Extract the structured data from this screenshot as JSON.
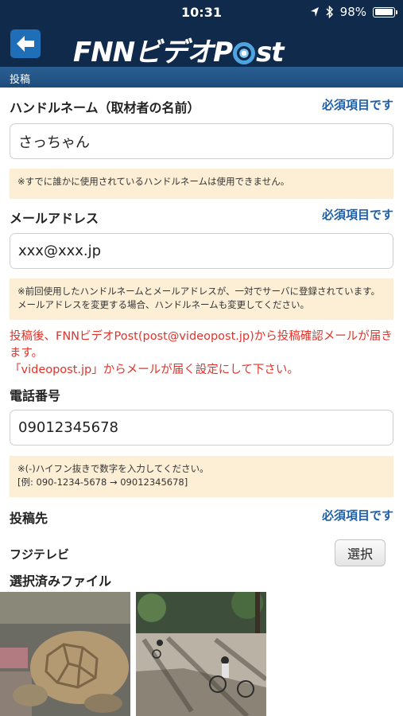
{
  "status_bar": {
    "time": "10:31",
    "battery": "98%",
    "battery_level": 0.98
  },
  "nav": {
    "logo_text_1": "FNN",
    "logo_text_2": "ビデオP",
    "logo_text_3": "st"
  },
  "section": {
    "title": "投稿"
  },
  "form": {
    "handle": {
      "label": "ハンドルネーム（取材者の名前）",
      "required": "必須項目です",
      "value": "さっちゃん",
      "note": "※すでに誰かに使用されているハンドルネームは使用できません。"
    },
    "email": {
      "label": "メールアドレス",
      "required": "必須項目です",
      "value": "xxx@xxx.jp",
      "note": "※前回使用したハンドルネームとメールアドレスが、一対でサーバに登録されています。メールアドレスを変更する場合、ハンドルネームも変更してください。"
    },
    "warning": {
      "line1": "投稿後、FNNビデオPost(post@videopost.jp)から投稿確認メールが届きます。",
      "line2": "「videopost.jp」からメールが届く設定にして下さい。"
    },
    "phone": {
      "label": "電話番号",
      "value": "09012345678",
      "note_line1": "※(-)ハイフン抜きで数字を入力してください。",
      "note_line2": "[例: 090-1234-5678 → 09012345678]"
    },
    "destination": {
      "label": "投稿先",
      "required": "必須項目です",
      "value": "フジテレビ",
      "select_label": "選択"
    },
    "files": {
      "label": "選択済みファイル"
    }
  },
  "colors": {
    "nav_bg": "#0f2a4a",
    "accent_blue": "#1e5fa8",
    "note_bg": "#fcefd6",
    "warning_red": "#e2332b"
  }
}
